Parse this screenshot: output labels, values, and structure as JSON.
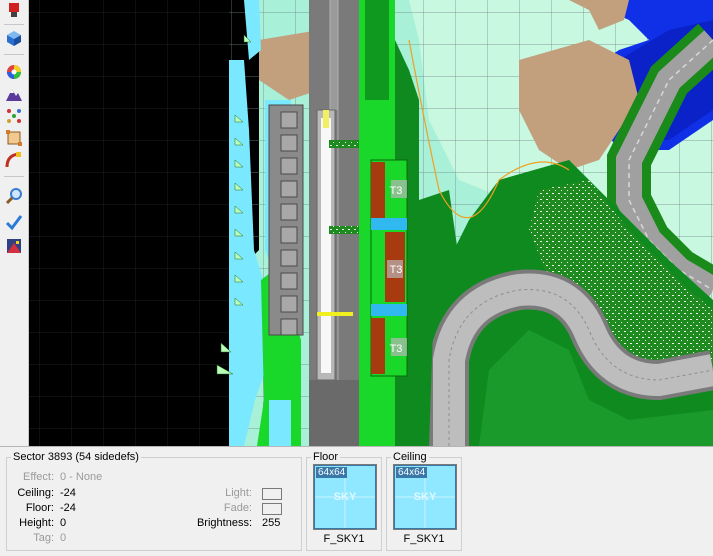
{
  "toolbar": {
    "tools": [
      {
        "name": "mode-3d-icon",
        "color": "#3a7fd8"
      },
      {
        "name": "color-wheel-icon",
        "color": "#d84a4a"
      },
      {
        "name": "terrain-icon",
        "color": "#6a3fa0"
      },
      {
        "name": "points-icon",
        "color": "#d03030"
      },
      {
        "name": "resize-icon",
        "color": "#d07a30"
      },
      {
        "name": "curve-icon",
        "color": "#c89020"
      },
      {
        "name": "search-icon",
        "color": "#3a8ad8"
      },
      {
        "name": "checkmark-icon",
        "color": "#2a7ad8"
      },
      {
        "name": "image-icon",
        "color": "#a03040"
      }
    ]
  },
  "map": {
    "tags": [
      "T3",
      "T3",
      "T3"
    ]
  },
  "sector": {
    "title": "Sector 3893 (54 sidedefs)",
    "effect_label": "Effect:",
    "effect_value": "0 - None",
    "ceiling_label": "Ceiling:",
    "ceiling_value": "-24",
    "floor_label": "Floor:",
    "floor_value": "-24",
    "height_label": "Height:",
    "height_value": "0",
    "tag_label": "Tag:",
    "tag_value": "0",
    "light_label": "Light:",
    "fade_label": "Fade:",
    "brightness_label": "Brightness:",
    "brightness_value": "255"
  },
  "floor": {
    "title": "Floor",
    "size": "64x64",
    "watermark": "SKY",
    "texture": "F_SKY1"
  },
  "ceiling": {
    "title": "Ceiling",
    "size": "64x64",
    "watermark": "SKY",
    "texture": "F_SKY1"
  }
}
